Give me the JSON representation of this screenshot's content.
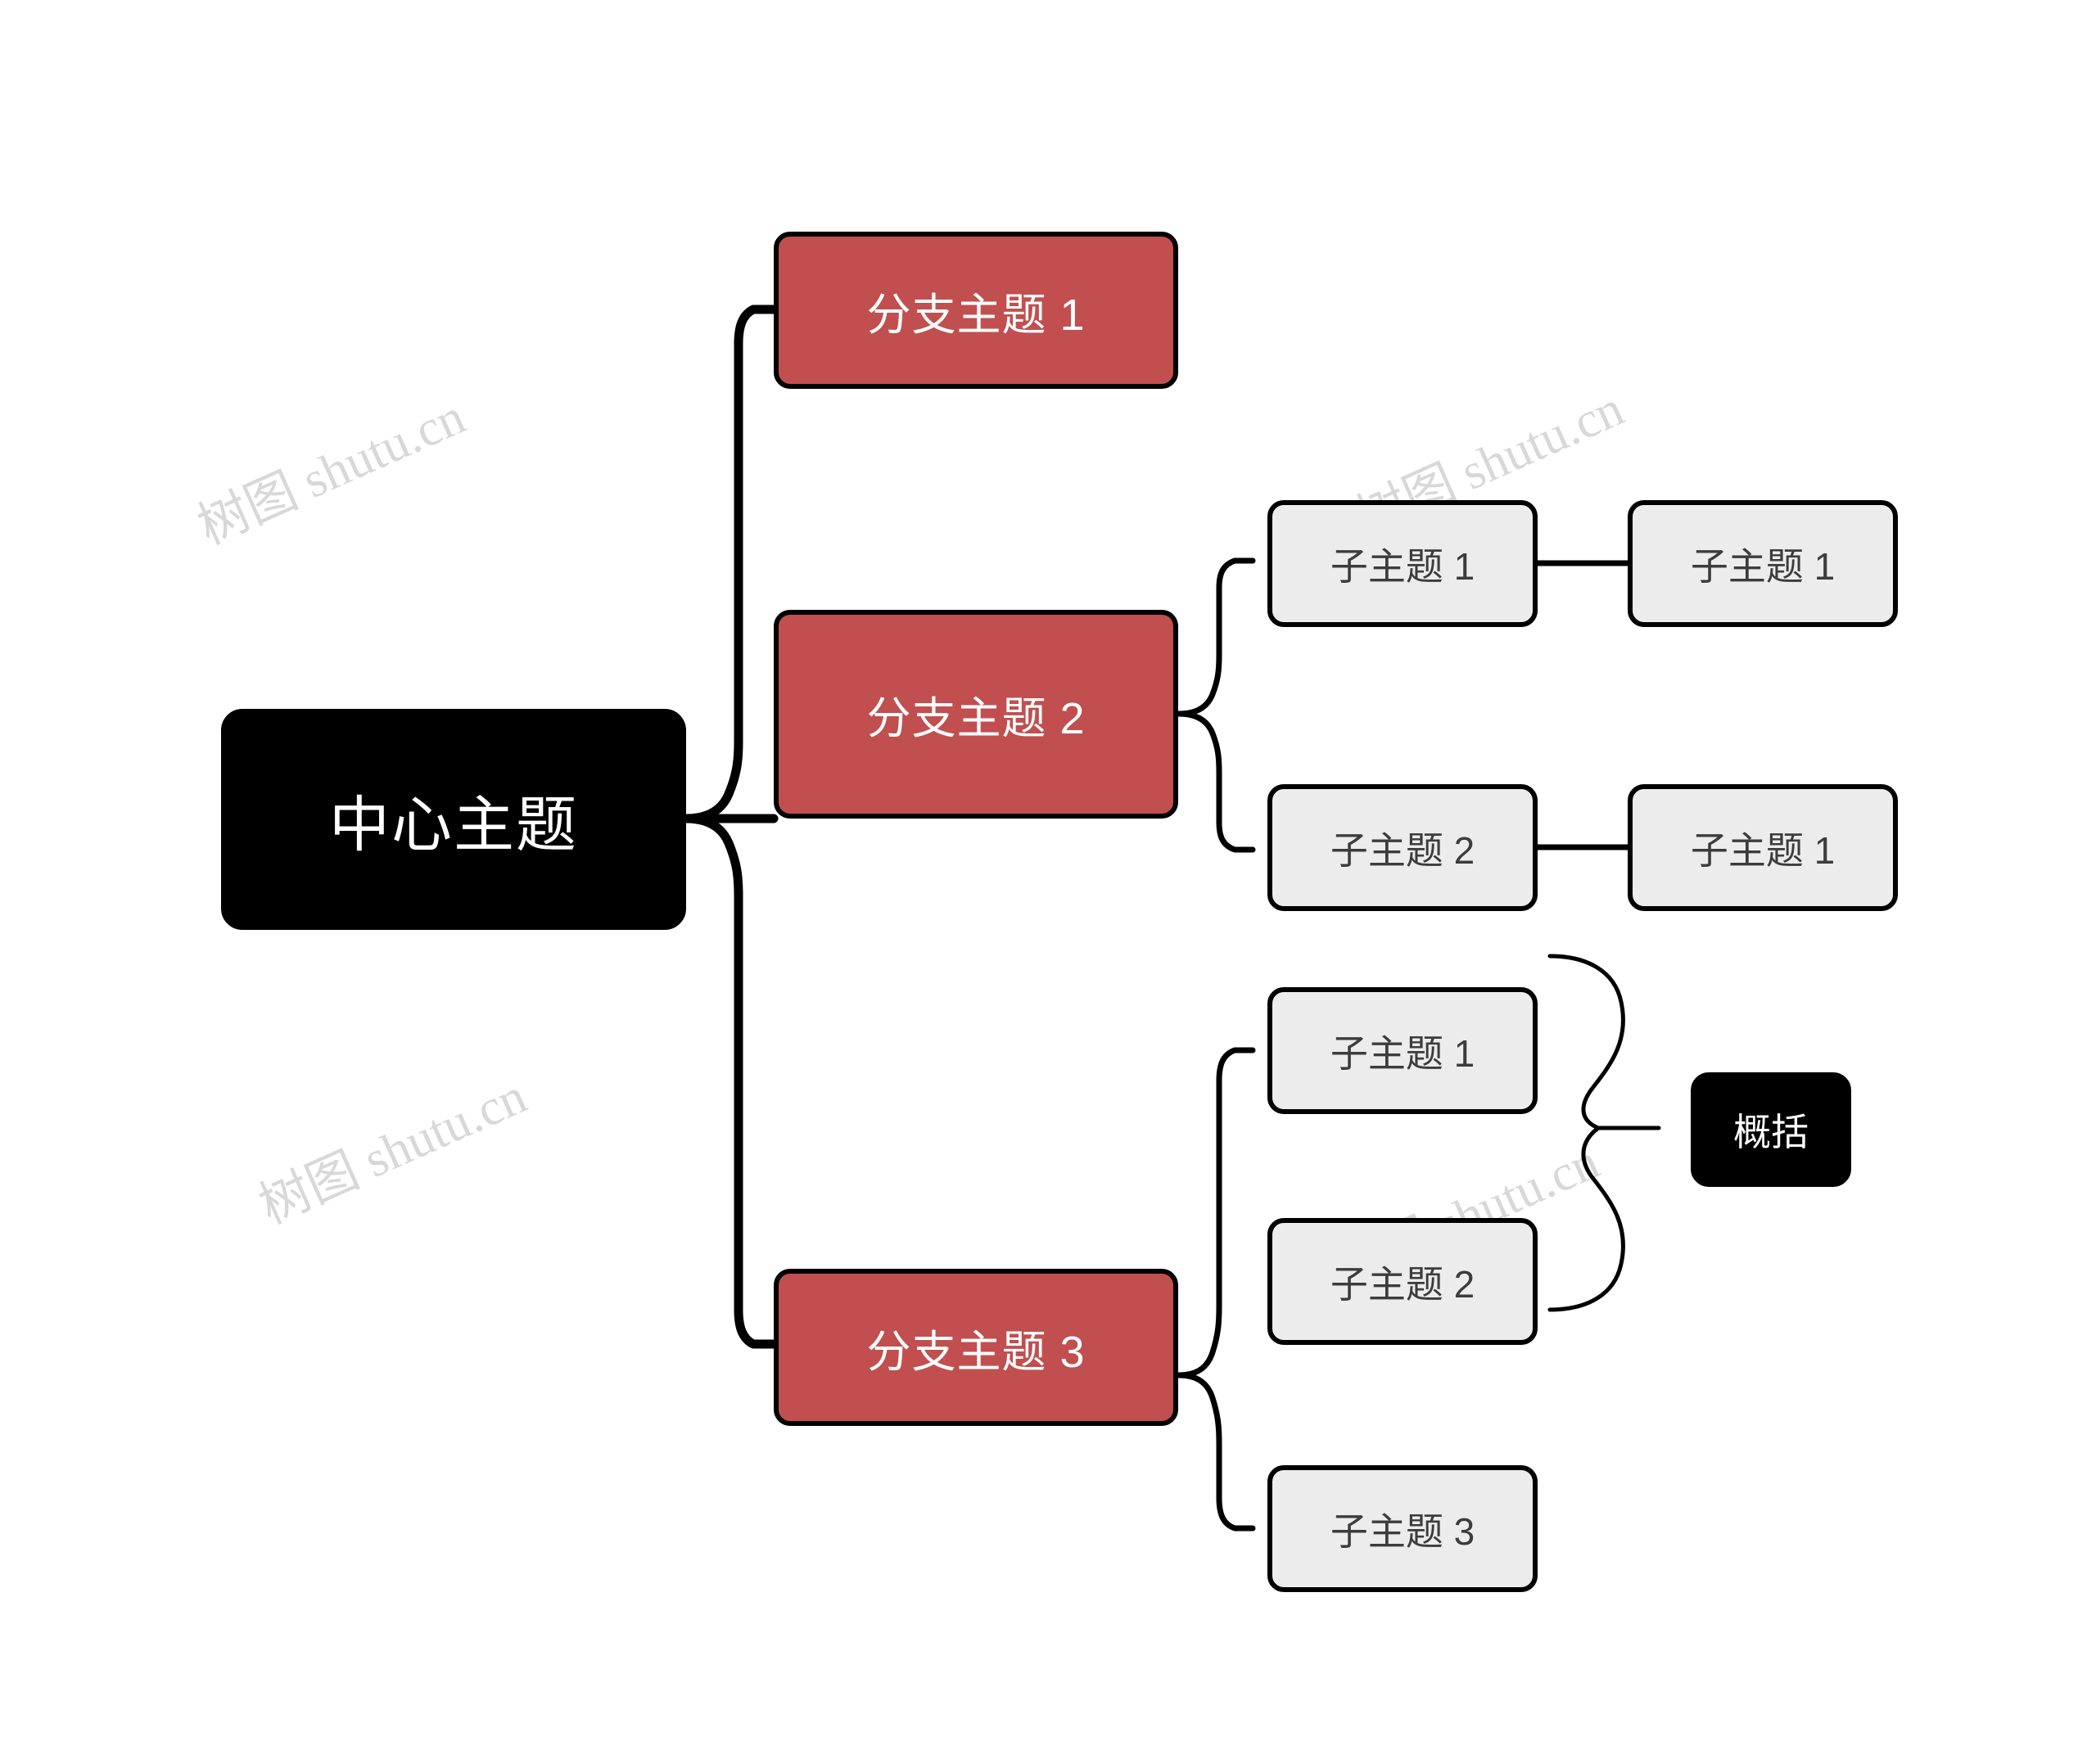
{
  "diagram": {
    "type": "mindmap",
    "background_color": "#ffffff",
    "root": {
      "label": "中心主题",
      "fill": "#000000",
      "text_color": "#ffffff"
    },
    "branch_fill": "#c14f4f",
    "branch_text_color": "#ffffff",
    "sub_fill": "#ececec",
    "sub_text_color": "#3c3c3c",
    "summary_fill": "#000000",
    "summary_text_color": "#ffffff",
    "stroke_color": "#000000",
    "branches": [
      {
        "label": "分支主题 1",
        "children": []
      },
      {
        "label": "分支主题 2",
        "children": [
          {
            "label": "子主题 1",
            "children": [
              {
                "label": "子主题 1"
              }
            ]
          },
          {
            "label": "子主题 2",
            "children": [
              {
                "label": "子主题 1"
              }
            ]
          }
        ]
      },
      {
        "label": "分支主题 3",
        "children": [
          {
            "label": "子主题 1",
            "children": []
          },
          {
            "label": "子主题 2",
            "children": []
          },
          {
            "label": "子主题 3",
            "children": []
          }
        ],
        "summary": {
          "label": "概括",
          "covers": [
            "子主题 1",
            "子主题 2"
          ]
        }
      }
    ]
  },
  "watermark": {
    "text": "树图 shutu.cn",
    "color": "#d8d8d8",
    "rotation_deg": -24
  }
}
